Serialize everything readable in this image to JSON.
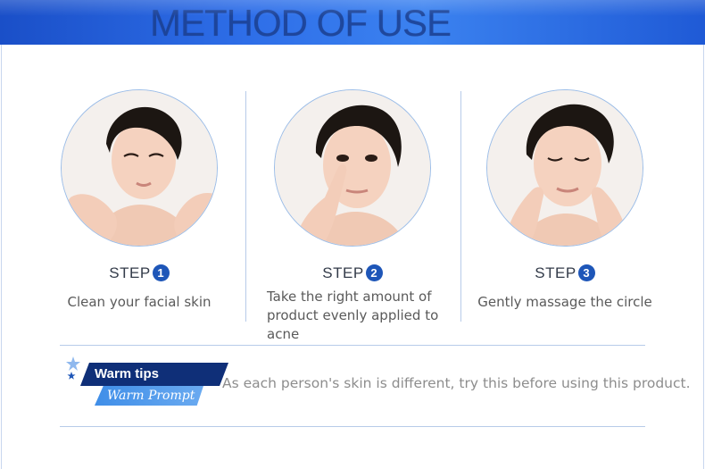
{
  "header": {
    "title": "METHOD OF USE"
  },
  "steps": [
    {
      "label": "STEP",
      "number": "1",
      "description": "Clean your facial skin"
    },
    {
      "label": "STEP",
      "number": "2",
      "description_lines": [
        "Take the right amount of",
        "product evenly applied to acne"
      ]
    },
    {
      "label": "STEP",
      "number": "3",
      "description": "Gently massage the circle"
    }
  ],
  "tips": {
    "title": "Warm tips",
    "subtitle": "Warm Prompt",
    "note": "As each person's skin is different, try this before using this product."
  },
  "colors": {
    "header_blue": "#2e6ee8",
    "title_navy": "#1b3f8f",
    "step_badge": "#1e56b8",
    "tips_navy": "#0f2f78",
    "tips_light": "#4f9aec",
    "divider": "#b7cbe9"
  }
}
